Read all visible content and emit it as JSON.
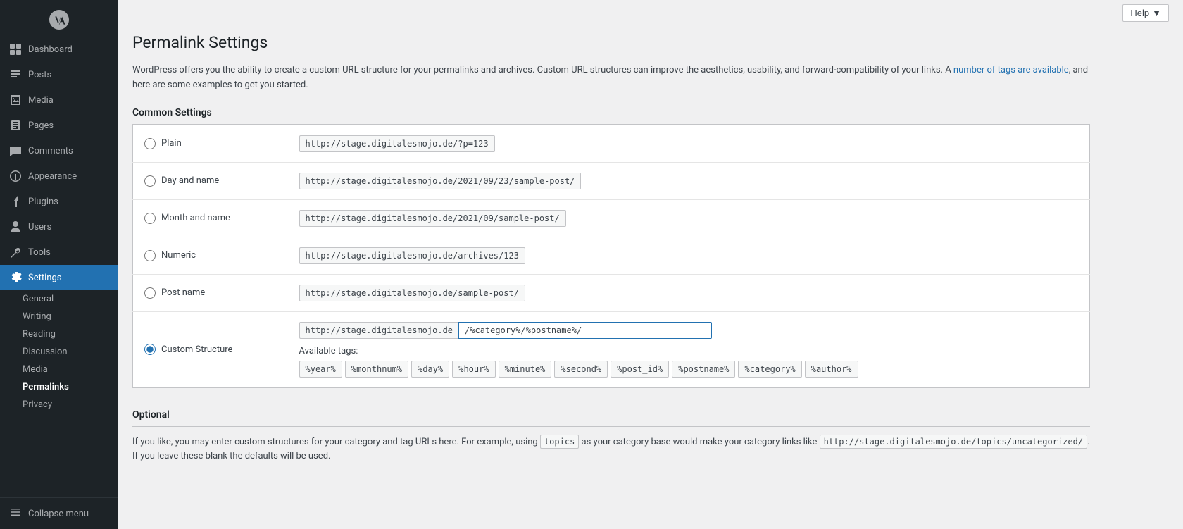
{
  "sidebar": {
    "logo_title": "WordPress",
    "nav_items": [
      {
        "id": "dashboard",
        "label": "Dashboard",
        "icon": "dashboard"
      },
      {
        "id": "posts",
        "label": "Posts",
        "icon": "posts"
      },
      {
        "id": "media",
        "label": "Media",
        "icon": "media"
      },
      {
        "id": "pages",
        "label": "Pages",
        "icon": "pages"
      },
      {
        "id": "comments",
        "label": "Comments",
        "icon": "comments"
      },
      {
        "id": "appearance",
        "label": "Appearance",
        "icon": "appearance"
      },
      {
        "id": "plugins",
        "label": "Plugins",
        "icon": "plugins"
      },
      {
        "id": "users",
        "label": "Users",
        "icon": "users"
      },
      {
        "id": "tools",
        "label": "Tools",
        "icon": "tools"
      },
      {
        "id": "settings",
        "label": "Settings",
        "icon": "settings",
        "active": true
      }
    ],
    "settings_sub": [
      {
        "id": "general",
        "label": "General"
      },
      {
        "id": "writing",
        "label": "Writing"
      },
      {
        "id": "reading",
        "label": "Reading"
      },
      {
        "id": "discussion",
        "label": "Discussion"
      },
      {
        "id": "media",
        "label": "Media"
      },
      {
        "id": "permalinks",
        "label": "Permalinks",
        "active": true
      },
      {
        "id": "privacy",
        "label": "Privacy"
      }
    ],
    "collapse_label": "Collapse menu"
  },
  "topbar": {
    "help_label": "Help",
    "help_arrow": "▼"
  },
  "page": {
    "title": "Permalink Settings",
    "intro_text": "WordPress offers you the ability to create a custom URL structure for your permalinks and archives. Custom URL structures can improve the aesthetics, usability, and forward-compatibility of your links. A ",
    "intro_link": "number of tags are available",
    "intro_text2": ", and here are some examples to get you started.",
    "common_settings_label": "Common Settings"
  },
  "permalink_options": [
    {
      "id": "plain",
      "label": "Plain",
      "example": "http://stage.digitalesmojo.de/?p=123",
      "selected": false
    },
    {
      "id": "day_name",
      "label": "Day and name",
      "example": "http://stage.digitalesmojo.de/2021/09/23/sample-post/",
      "selected": false
    },
    {
      "id": "month_name",
      "label": "Month and name",
      "example": "http://stage.digitalesmojo.de/2021/09/sample-post/",
      "selected": false
    },
    {
      "id": "numeric",
      "label": "Numeric",
      "example": "http://stage.digitalesmojo.de/archives/123",
      "selected": false
    },
    {
      "id": "post_name",
      "label": "Post name",
      "example": "http://stage.digitalesmojo.de/sample-post/",
      "selected": false
    }
  ],
  "custom_structure": {
    "label": "Custom Structure",
    "selected": true,
    "prefix": "http://stage.digitalesmojo.de",
    "value": "/%category%/%postname%/"
  },
  "available_tags": {
    "label": "Available tags:",
    "tags": [
      "%year%",
      "%monthnum%",
      "%day%",
      "%hour%",
      "%minute%",
      "%second%",
      "%post_id%",
      "%postname%",
      "%category%",
      "%author%"
    ]
  },
  "optional": {
    "section_label": "Optional",
    "text_before": "If you like, you may enter custom structures for your category and tag URLs here. For example, using ",
    "topics_code": "topics",
    "text_after": " as your category base would make your category links like ",
    "example_url": "http://stage.digitalesmojo.de/topics/uncategorized/",
    "text_end": ". If you leave these blank the defaults will be used."
  }
}
